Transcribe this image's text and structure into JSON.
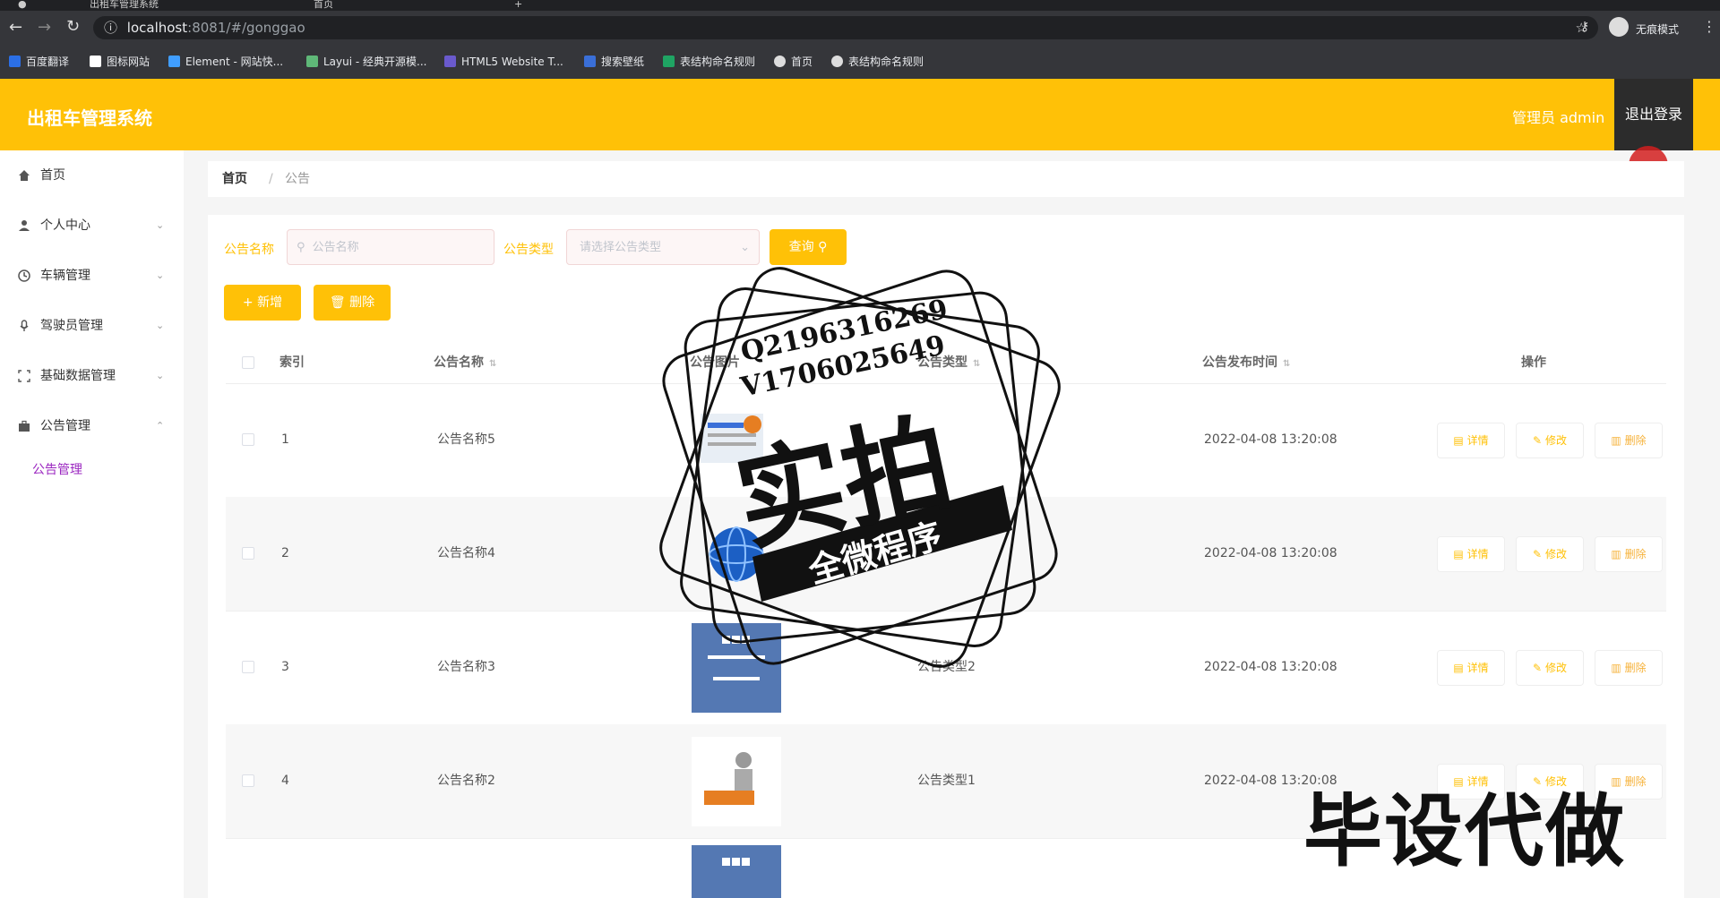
{
  "browser": {
    "tabs": [
      {
        "label": "出租车管理系统"
      },
      {
        "label": "首页"
      }
    ],
    "url_host": "localhost",
    "url_rest": ":8081/#/gonggao",
    "profile": "无痕模式",
    "bookmarks": [
      {
        "label": "百度翻译",
        "color": "#2b6fe6"
      },
      {
        "label": "图标网站",
        "color": "#ffffff"
      },
      {
        "label": "Element - 网站快...",
        "color": "#409eff"
      },
      {
        "label": "Layui - 经典开源模...",
        "color": "#5fb878"
      },
      {
        "label": "HTML5 Website T...",
        "color": "#6a5acd"
      },
      {
        "label": "搜索壁纸",
        "color": "#3a6fd8"
      },
      {
        "label": "表结构命名规则",
        "color": "#1fa463"
      },
      {
        "label": "首页",
        "color": "#dddddd"
      },
      {
        "label": "表结构命名规则",
        "color": "#dddddd"
      }
    ]
  },
  "header": {
    "title": "出租车管理系统",
    "admin": "管理员 admin",
    "logout": "退出登录",
    "accent": "#ffc107"
  },
  "sidebar": {
    "items": [
      {
        "label": "首页",
        "icon": "home-icon"
      },
      {
        "label": "个人中心",
        "icon": "user-icon"
      },
      {
        "label": "车辆管理",
        "icon": "clock-icon"
      },
      {
        "label": "驾驶员管理",
        "icon": "mic-icon"
      },
      {
        "label": "基础数据管理",
        "icon": "frame-icon"
      },
      {
        "label": "公告管理",
        "icon": "briefcase-icon"
      }
    ],
    "sub_active": "公告管理"
  },
  "breadcrumb": {
    "home": "首页",
    "current": "公告"
  },
  "search": {
    "name_label": "公告名称",
    "name_placeholder": "公告名称",
    "type_label": "公告类型",
    "type_placeholder": "请选择公告类型",
    "query": "查询"
  },
  "toolbar": {
    "add": "新增",
    "delete": "删除"
  },
  "table": {
    "columns": [
      "索引",
      "公告名称",
      "公告图片",
      "公告类型",
      "公告发布时间",
      "操作"
    ],
    "actions": {
      "detail": "详情",
      "edit": "修改",
      "delete": "删除"
    },
    "rows": [
      {
        "index": "1",
        "name": "公告名称5",
        "type": "",
        "time": "2022-04-08 13:20:08"
      },
      {
        "index": "2",
        "name": "公告名称4",
        "type": "",
        "time": "2022-04-08 13:20:08"
      },
      {
        "index": "3",
        "name": "公告名称3",
        "type": "公告类型2",
        "time": "2022-04-08 13:20:08"
      },
      {
        "index": "4",
        "name": "公告名称2",
        "type": "公告类型1",
        "time": "2022-04-08 13:20:08"
      }
    ]
  },
  "watermark": {
    "line1": "Q2196316269",
    "line2": "V1706025649",
    "big": "实拍",
    "band": "全微程序",
    "corner": "毕设代做"
  }
}
